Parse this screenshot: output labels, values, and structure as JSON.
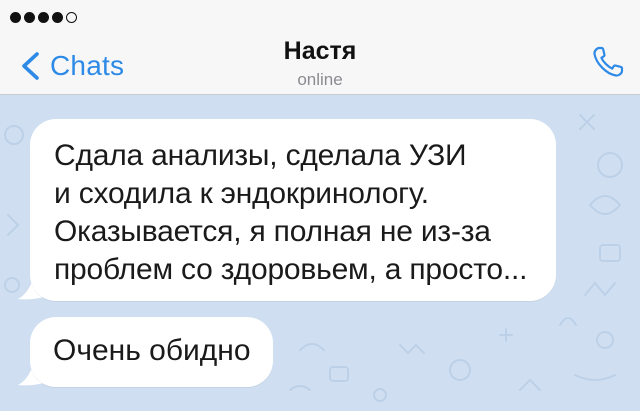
{
  "status_bar": {
    "signal_filled": 4,
    "signal_total": 5
  },
  "header": {
    "back_label": "Chats",
    "title": "Настя",
    "status": "online",
    "call_icon": "phone-icon",
    "accent_color": "#2d8ae6"
  },
  "chat": {
    "background_color": "#cfdff1",
    "messages": [
      {
        "lines": [
          "Сдала анализы, сделала УЗИ",
          "и сходила к эндокринологу.",
          "Оказывается, я полная не из-за",
          "проблем со здоровьем, а просто..."
        ]
      },
      {
        "lines": [
          "Очень обидно"
        ]
      }
    ]
  }
}
